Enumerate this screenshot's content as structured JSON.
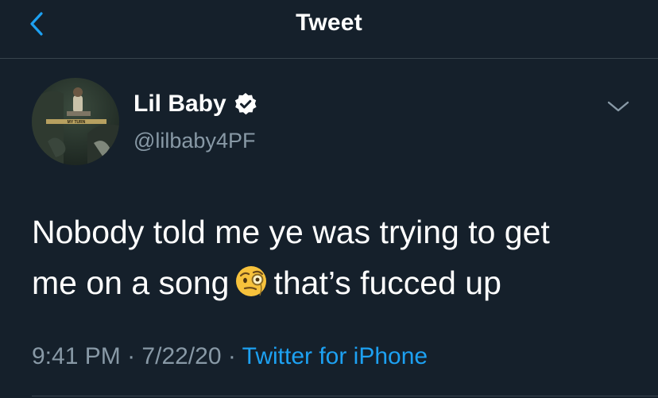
{
  "header": {
    "title": "Tweet",
    "back_icon": "chevron-left-icon"
  },
  "tweet": {
    "author": {
      "display_name": "Lil Baby",
      "handle": "@lilbaby4PF",
      "verified_icon": "verified-badge-icon",
      "avatar_text": "MY TURN"
    },
    "text_line1": "Nobody told me ye was trying to get",
    "text_line2_before": "me on a song",
    "emoji": "face-with-monocle",
    "text_line2_after": "that’s fucced up",
    "time": "9:41 PM",
    "separator": "·",
    "date": "7/22/20",
    "source": "Twitter for iPhone"
  },
  "colors": {
    "background": "#15202b",
    "accent": "#1da1f2",
    "secondary_text": "#8899a6",
    "divider": "#38444d"
  }
}
